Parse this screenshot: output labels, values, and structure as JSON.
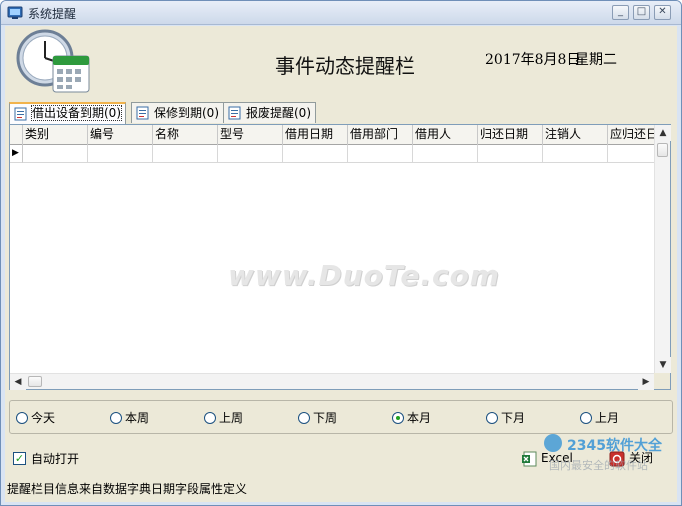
{
  "window": {
    "title": "系统提醒",
    "buttons": {
      "minimize": "_",
      "maximize": "□",
      "close": "✕"
    }
  },
  "header": {
    "title": "事件动态提醒栏",
    "date": "2017年8月8日",
    "weekday": "星期二"
  },
  "tabs": [
    {
      "label": "借出设备到期(0)",
      "active": true
    },
    {
      "label": "保修到期(0)",
      "active": false
    },
    {
      "label": "报废提醒(0)",
      "active": false
    }
  ],
  "grid": {
    "columns": [
      "类别",
      "编号",
      "名称",
      "型号",
      "借用日期",
      "借用部门",
      "借用人",
      "归还日期",
      "注销人",
      "应归还日"
    ],
    "current_row_marker": "▶"
  },
  "watermark": "www.DuoTe.com",
  "filters": {
    "options": [
      "今天",
      "本周",
      "上周",
      "下周",
      "本月",
      "下月",
      "上月"
    ],
    "selected": "本月"
  },
  "auto_open": {
    "label": "自动打开",
    "checked": true
  },
  "buttons": {
    "excel": "Excel",
    "close": "关闭"
  },
  "status_text": "提醒栏目信息来自数据字典日期字段属性定义",
  "logo": {
    "brand": "2345软件大全",
    "tagline": "国内最安全的软件站"
  },
  "colors": {
    "title_bar": "#d9e4f3",
    "panel": "#ece9d8",
    "grid_border": "#7f9db9",
    "tab_highlight": "#f1b34c"
  }
}
